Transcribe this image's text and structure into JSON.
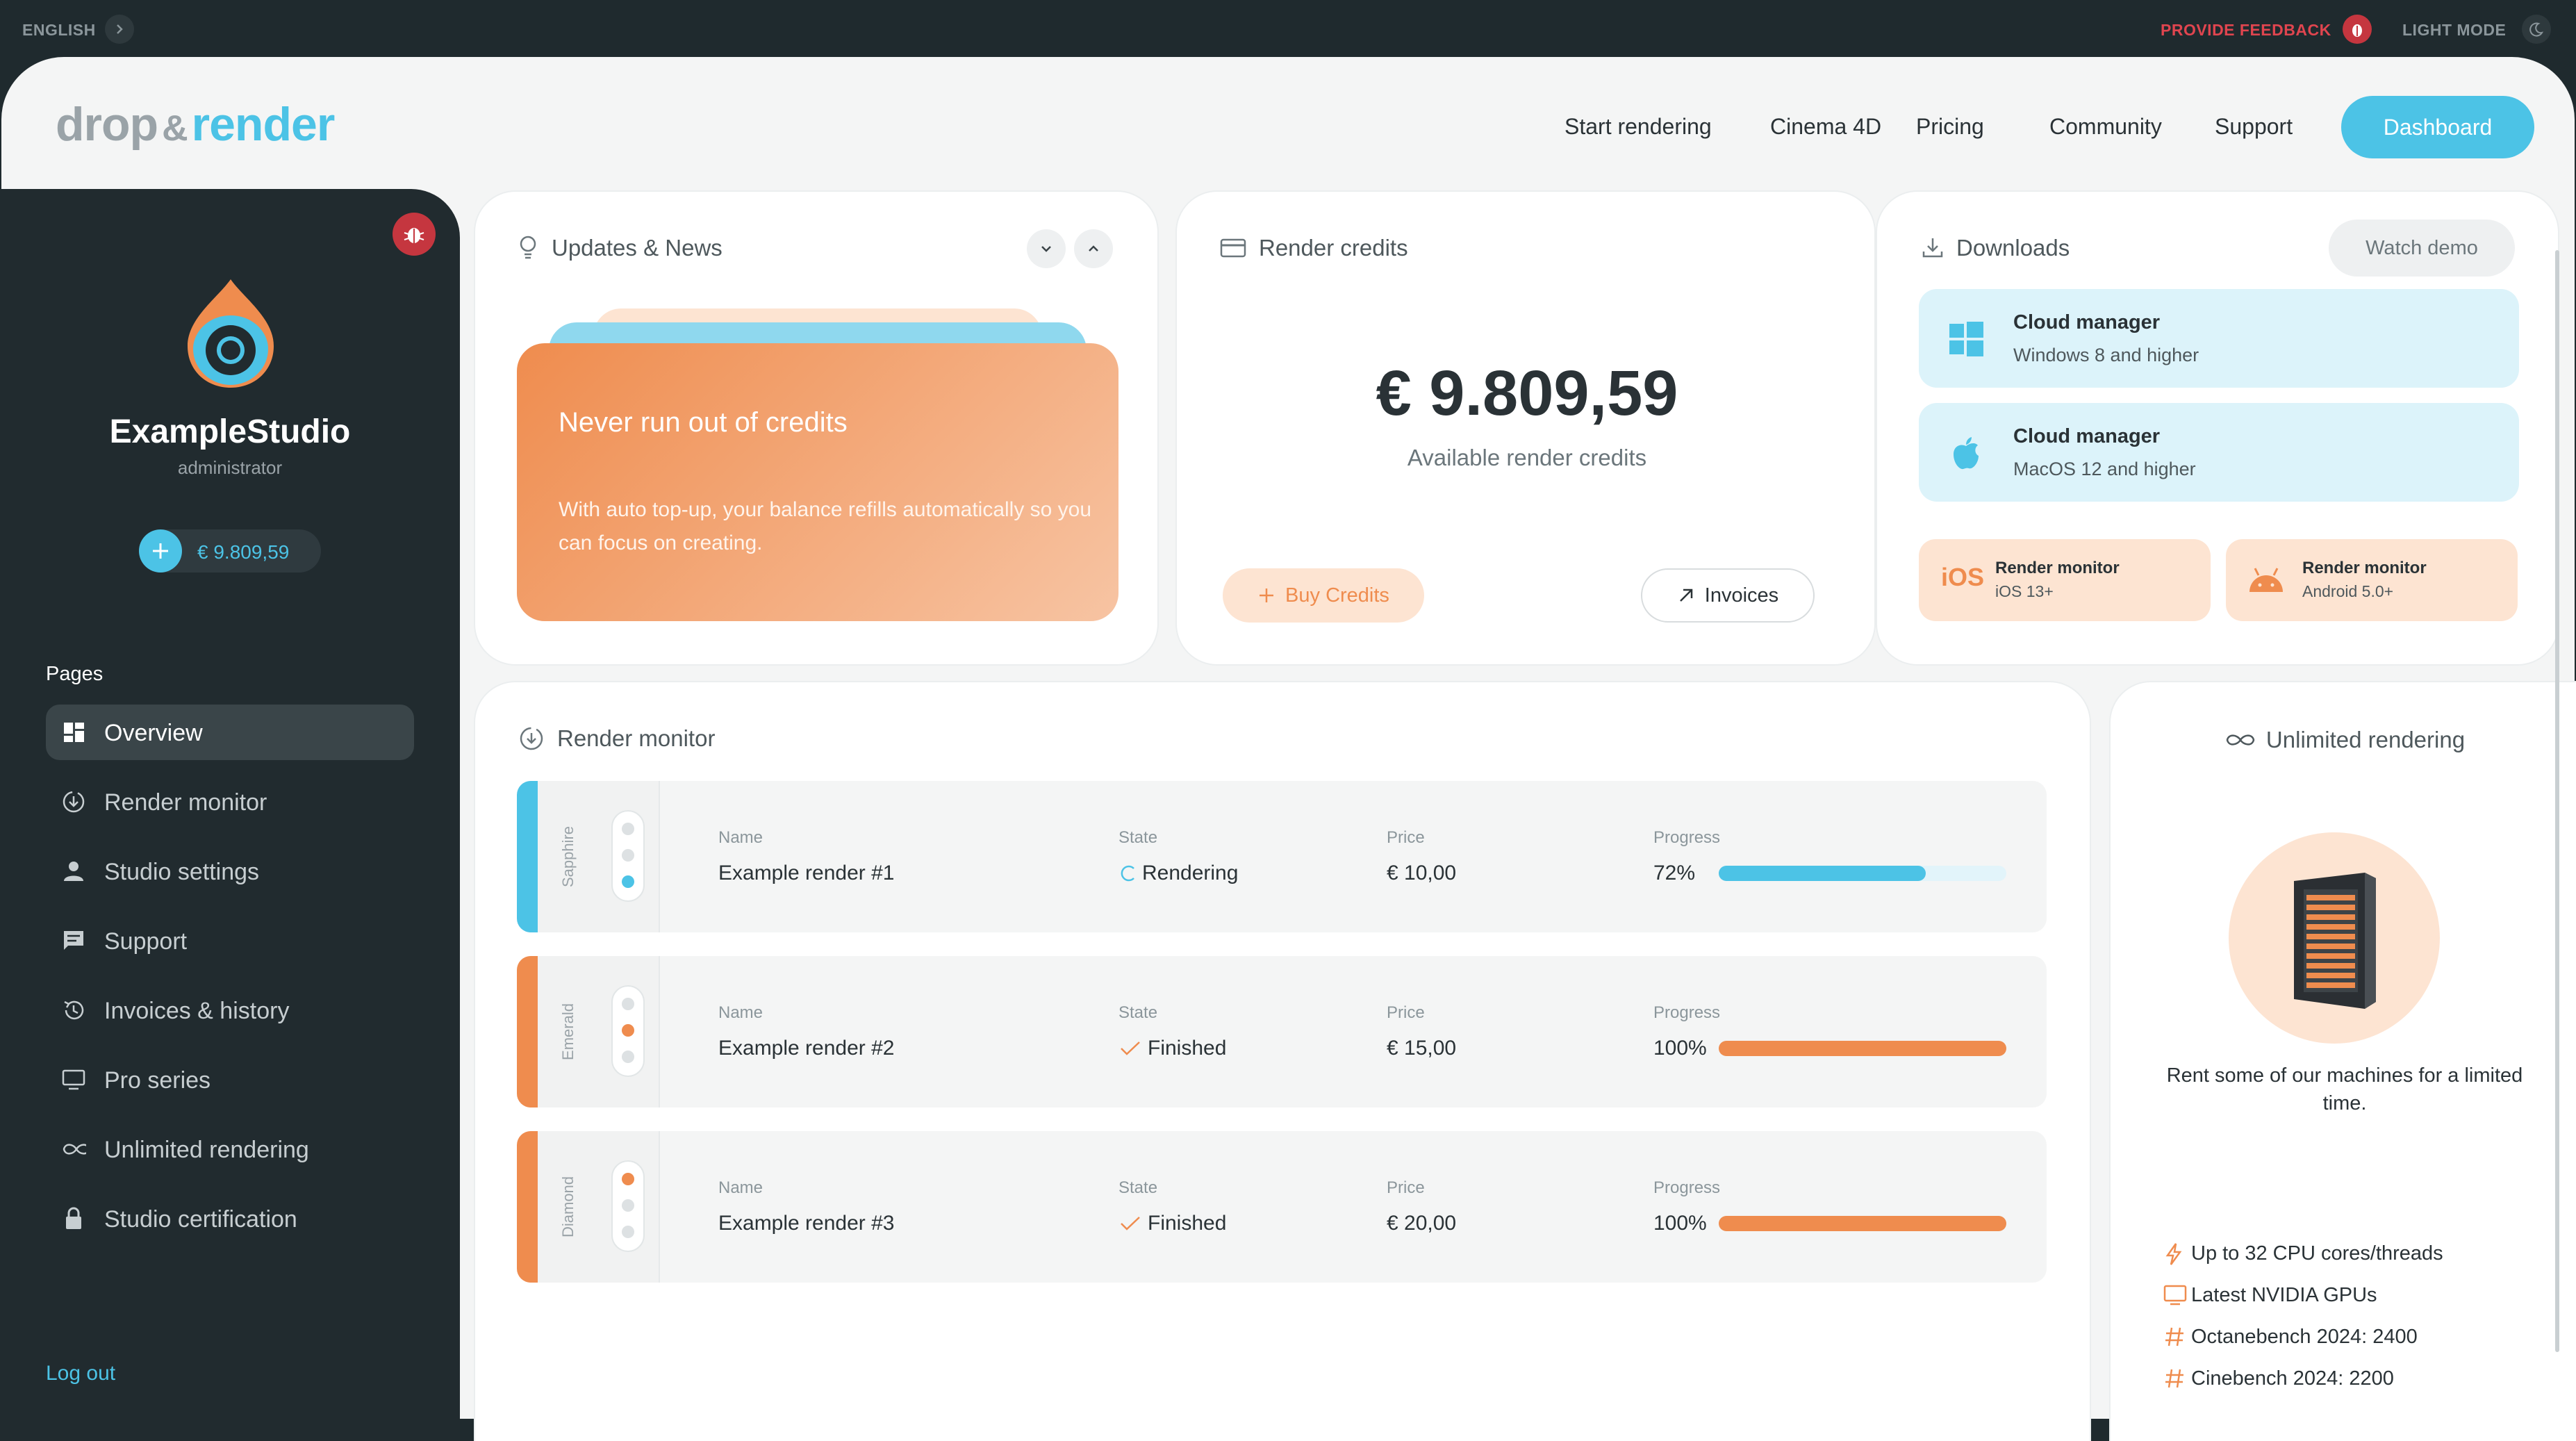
{
  "topbar": {
    "language": "ENGLISH",
    "feedback": "PROVIDE FEEDBACK",
    "mode": "LIGHT MODE"
  },
  "header": {
    "logo_part1": "drop",
    "logo_amp": "&",
    "logo_part2": "render",
    "nav": [
      "Start rendering",
      "Cinema 4D",
      "Pricing",
      "Community",
      "Support"
    ],
    "dashboard_label": "Dashboard"
  },
  "sidebar": {
    "studio_name": "ExampleStudio",
    "role": "administrator",
    "credit": "€ 9.809,59",
    "pages_title": "Pages",
    "items": [
      {
        "label": "Overview",
        "icon": "grid-icon"
      },
      {
        "label": "Render monitor",
        "icon": "monitor-download-icon"
      },
      {
        "label": "Studio settings",
        "icon": "user-icon"
      },
      {
        "label": "Support",
        "icon": "chat-icon"
      },
      {
        "label": "Invoices & history",
        "icon": "history-icon"
      },
      {
        "label": "Pro series",
        "icon": "display-icon"
      },
      {
        "label": "Unlimited rendering",
        "icon": "infinity-icon"
      },
      {
        "label": "Studio certification",
        "icon": "lock-icon"
      }
    ],
    "logout": "Log out"
  },
  "news": {
    "title": "Updates & News",
    "headline": "Never run out of credits",
    "body": "With auto top-up, your balance refills automatically so you can focus on creating."
  },
  "credits": {
    "title": "Render credits",
    "amount": "€ 9.809,59",
    "caption": "Available render credits",
    "buy_label": "Buy Credits",
    "invoices_label": "Invoices"
  },
  "downloads": {
    "title": "Downloads",
    "watch_demo": "Watch demo",
    "items": [
      {
        "name": "Cloud manager",
        "sub": "Windows 8 and higher"
      },
      {
        "name": "Cloud manager",
        "sub": "MacOS 12 and higher"
      },
      {
        "name": "Render monitor",
        "sub": "iOS 13+"
      },
      {
        "name": "Render monitor",
        "sub": "Android 5.0+"
      }
    ],
    "ios_badge": "iOS"
  },
  "monitor": {
    "title": "Render monitor",
    "labels": {
      "name": "Name",
      "state": "State",
      "price": "Price",
      "progress": "Progress"
    },
    "jobs": [
      {
        "tier": "Sapphire",
        "name": "Example render #1",
        "state": "Rendering",
        "price": "€ 10,00",
        "progress_text": "72%",
        "progress": 0.72,
        "color": "#4cc3e6"
      },
      {
        "tier": "Emerald",
        "name": "Example render #2",
        "state": "Finished",
        "price": "€ 15,00",
        "progress_text": "100%",
        "progress": 1.0,
        "color": "#ef8c4e"
      },
      {
        "tier": "Diamond",
        "name": "Example render #3",
        "state": "Finished",
        "price": "€ 20,00",
        "progress_text": "100%",
        "progress": 1.0,
        "color": "#ef8c4e"
      }
    ]
  },
  "unlimited": {
    "title": "Unlimited rendering",
    "description": "Rent some of our machines for a limited time.",
    "features": [
      "Up to 32 CPU cores/threads",
      "Latest NVIDIA GPUs",
      "Octanebench 2024: 2400",
      "Cinebench 2024: 2200"
    ]
  },
  "colors": {
    "accent_blue": "#4cc3e6",
    "accent_orange": "#ef8c4e",
    "sidebar_bg": "#212b2f",
    "danger": "#c5363f"
  }
}
